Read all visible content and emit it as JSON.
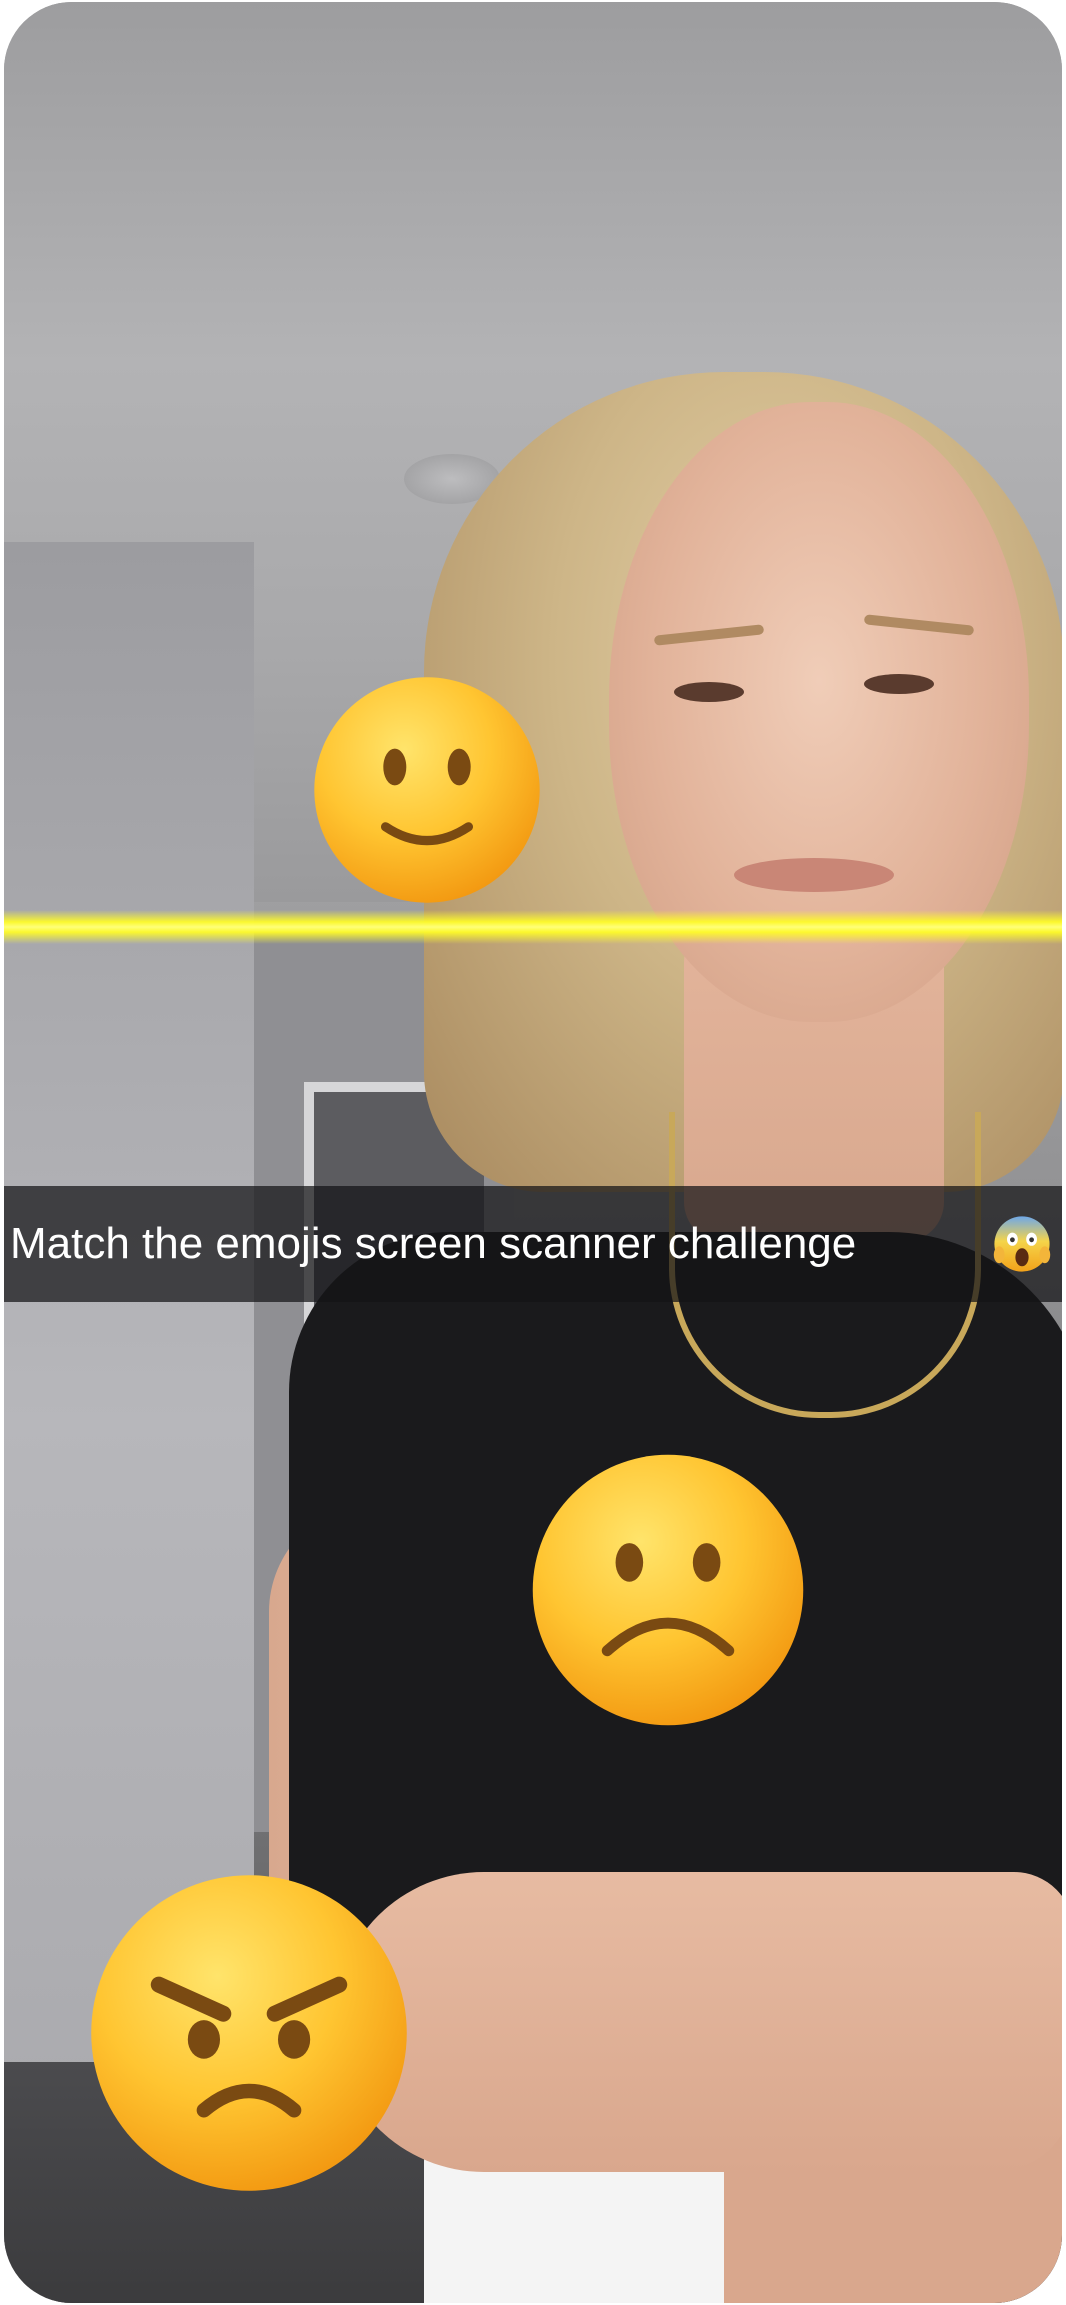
{
  "video": {
    "caption": "Match the emojis screen scanner challenge"
  },
  "overlay": {
    "scan_line_color": "#FFFF3A",
    "emojis": [
      "slightly-smiling-face-icon",
      "frowning-face-icon",
      "angry-face-icon"
    ],
    "caption_emoji": "face-screaming-in-fear-icon"
  }
}
